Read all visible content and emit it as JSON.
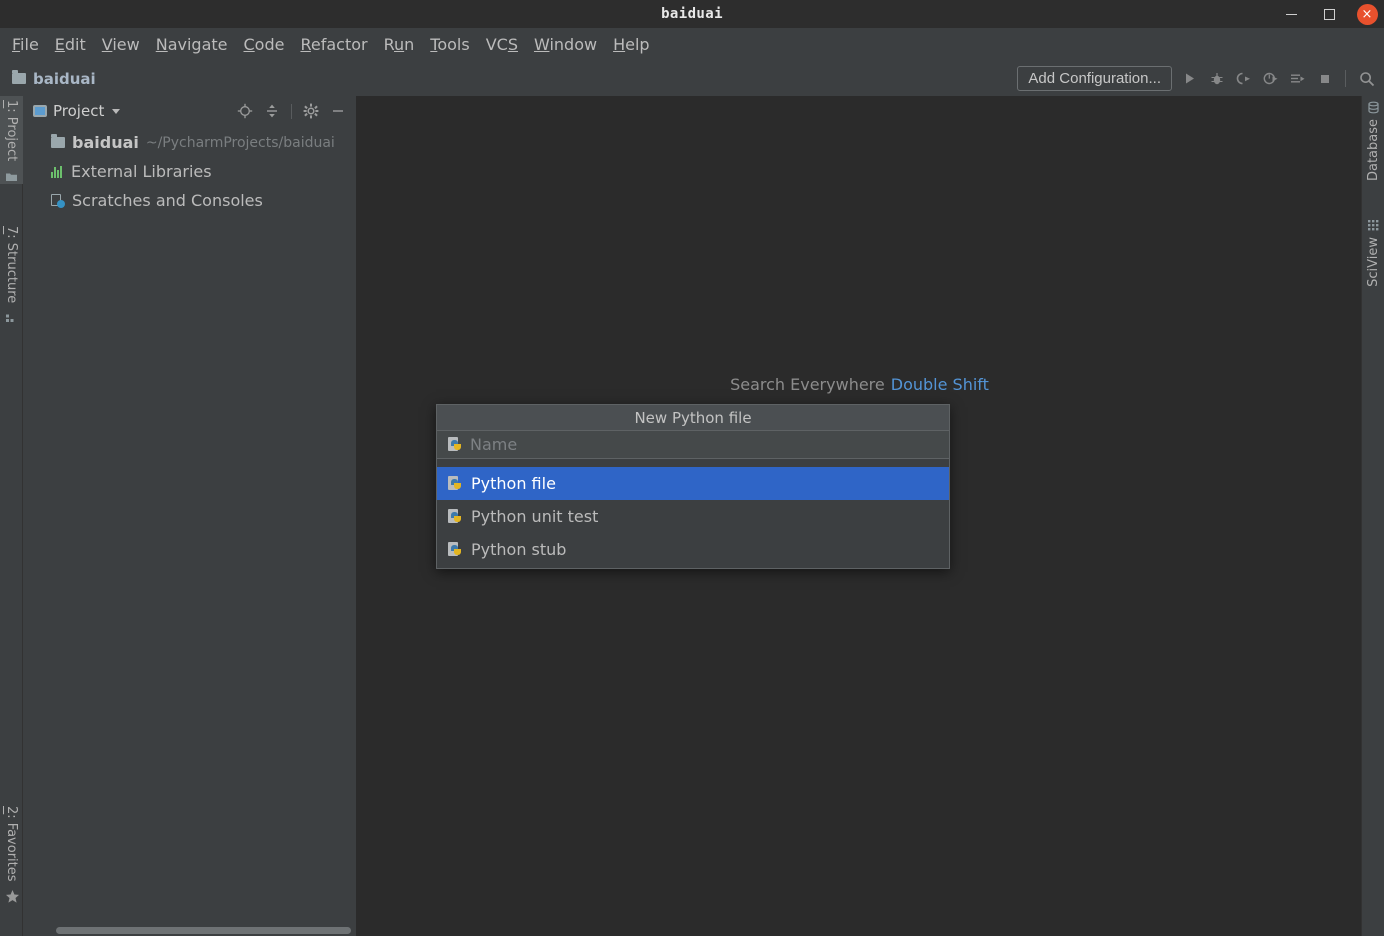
{
  "window": {
    "title": "baiduai",
    "controls": {
      "minimize": "minimize-button",
      "maximize": "maximize-button",
      "close": "×"
    }
  },
  "menubar": {
    "items": [
      {
        "label": "File",
        "mnemonic": "F"
      },
      {
        "label": "Edit",
        "mnemonic": "E"
      },
      {
        "label": "View",
        "mnemonic": "V"
      },
      {
        "label": "Navigate",
        "mnemonic": "N"
      },
      {
        "label": "Code",
        "mnemonic": "C"
      },
      {
        "label": "Refactor",
        "mnemonic": "R"
      },
      {
        "label": "Run",
        "mnemonic": "u"
      },
      {
        "label": "Tools",
        "mnemonic": "T"
      },
      {
        "label": "VCS",
        "mnemonic": "S"
      },
      {
        "label": "Window",
        "mnemonic": "W"
      },
      {
        "label": "Help",
        "mnemonic": "H"
      }
    ]
  },
  "navbar": {
    "breadcrumb": "baiduai",
    "run_config": "Add Configuration...",
    "toolbar_icons": [
      "run-icon",
      "debug-icon",
      "run-with-coverage-icon",
      "profile-icon",
      "run-to-cursor-icon",
      "stop-icon",
      "search-icon"
    ]
  },
  "left_strip": {
    "tabs": [
      {
        "label": "1: Project",
        "mnemonic": "1",
        "active": true,
        "icon": "project-folder-icon"
      },
      {
        "label": "7: Structure",
        "mnemonic": "7",
        "active": false,
        "icon": "structure-icon"
      },
      {
        "label": "2: Favorites",
        "mnemonic": "2",
        "active": false,
        "icon": "star-icon"
      }
    ]
  },
  "right_strip": {
    "tabs": [
      {
        "label": "Database",
        "icon": "database-icon"
      },
      {
        "label": "SciView",
        "icon": "sciview-grid-icon"
      }
    ]
  },
  "project_panel": {
    "title": "Project",
    "actions": [
      "select-opened-file-icon",
      "collapse-all-icon",
      "settings-gear-icon",
      "hide-panel-icon"
    ],
    "tree": [
      {
        "label": "baiduai",
        "sub": "~/PycharmProjects/baiduai",
        "icon": "folder-icon",
        "bold": true
      },
      {
        "label": "External Libraries",
        "sub": "",
        "icon": "library-icon",
        "bold": false
      },
      {
        "label": "Scratches and Consoles",
        "sub": "",
        "icon": "scratches-icon",
        "bold": false
      }
    ]
  },
  "editor": {
    "hint_text": "Search Everywhere",
    "hint_shortcut": "Double Shift"
  },
  "popup": {
    "title": "New Python file",
    "name_placeholder": "Name",
    "name_value": "",
    "options": [
      {
        "label": "Python file",
        "icon": "python-file-icon",
        "selected": true
      },
      {
        "label": "Python unit test",
        "icon": "python-file-icon",
        "selected": false
      },
      {
        "label": "Python stub",
        "icon": "python-file-icon",
        "selected": false
      }
    ]
  },
  "colors": {
    "accent_selection": "#2f65c7",
    "panel_bg": "#3c3f41",
    "editor_bg": "#2b2b2b",
    "link_blue": "#5394d6",
    "close_button": "#e8512d"
  }
}
